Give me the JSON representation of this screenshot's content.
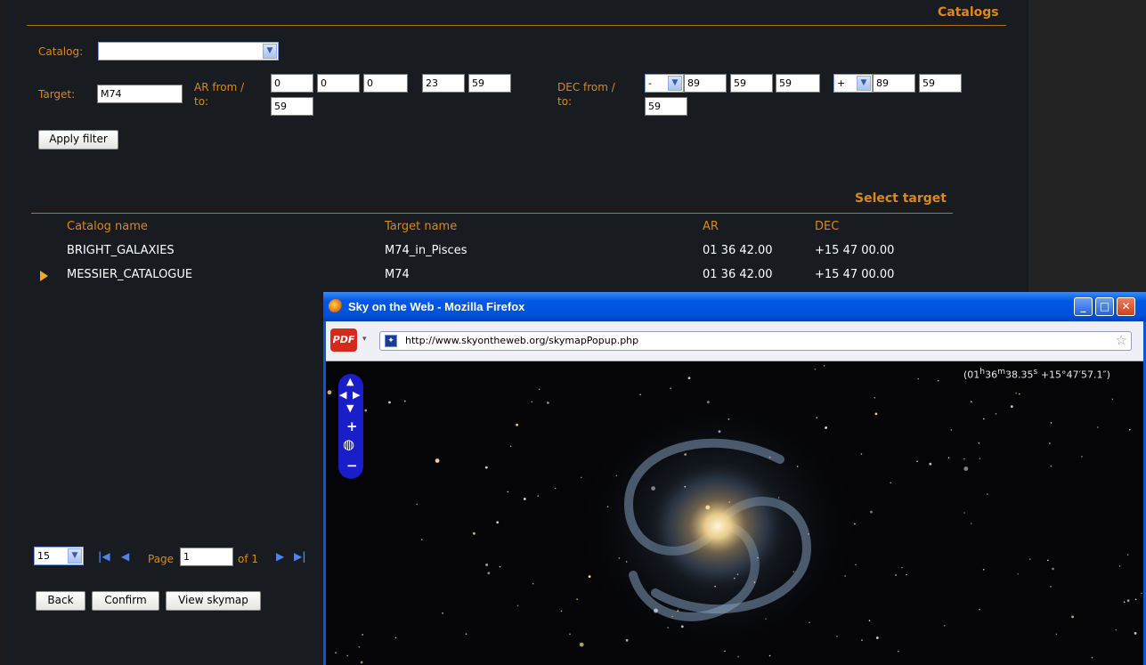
{
  "panel": {
    "title": "Catalogs",
    "catalog_label": "Catalog:",
    "catalog_value": "",
    "target_label": "Target:",
    "target_value": "M74",
    "ar_label_1": "AR from /",
    "ar_label_2": "to:",
    "ar_from": [
      "0",
      "0",
      "0"
    ],
    "ar_to": [
      "23",
      "59",
      "59"
    ],
    "dec_label_1": "DEC from /",
    "dec_label_2": "to:",
    "dec_from_sign": "-",
    "dec_from": [
      "89",
      "59",
      "59"
    ],
    "dec_to_sign": "+",
    "dec_to": [
      "89",
      "59",
      "59"
    ],
    "apply_filter": "Apply filter"
  },
  "results": {
    "title": "Select target",
    "columns": [
      "Catalog name",
      "Target name",
      "AR",
      "DEC"
    ],
    "rows": [
      {
        "catalog": "BRIGHT_GALAXIES",
        "target": "M74_in_Pisces",
        "ar": "01 36 42.00",
        "dec": "+15 47 00.00",
        "selected": false
      },
      {
        "catalog": "MESSIER_CATALOGUE",
        "target": "M74",
        "ar": "01 36 42.00",
        "dec": "+15 47 00.00",
        "selected": true
      }
    ]
  },
  "pagination": {
    "page_size": "15",
    "page_label": "Page",
    "page_value": "1",
    "of_label": "of 1"
  },
  "actions": {
    "back": "Back",
    "confirm": "Confirm",
    "view_skymap": "View skymap"
  },
  "popup": {
    "window_title": "Sky on the Web - Mozilla Firefox",
    "url": "http://www.skyontheweb.org/skymapPopup.php",
    "pdf_label": "PDF",
    "coordinates": "(01h36m38.35s +15°47′57.1″)",
    "coord_parts": {
      "h": "01",
      "m": "36",
      "s": "38.35",
      "dec": "+15°47′57.1″"
    }
  },
  "colors": {
    "accent": "#d98a1b",
    "background": "#181b20",
    "xp_blue": "#0058e6"
  }
}
